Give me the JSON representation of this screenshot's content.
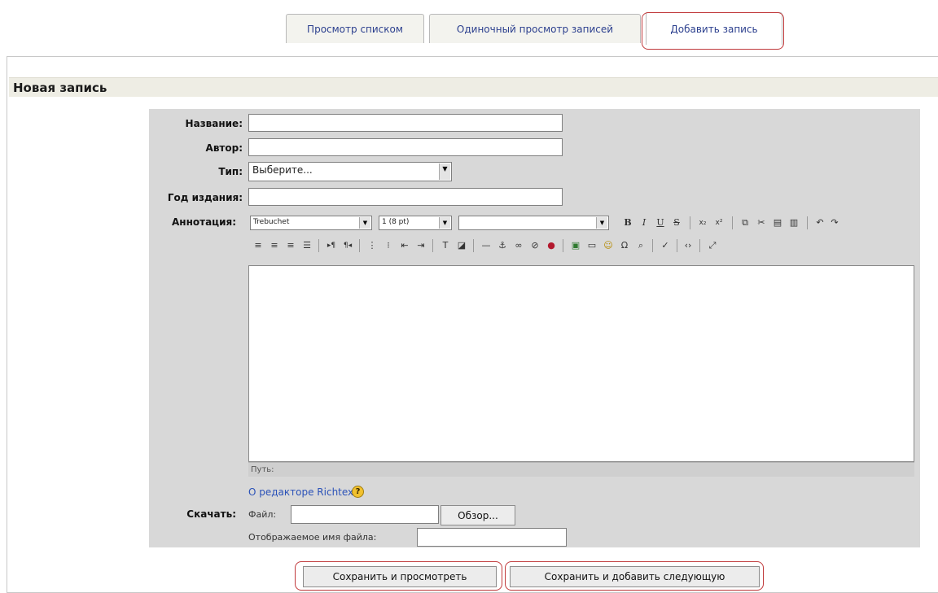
{
  "tabs": [
    {
      "label": "Просмотр списком"
    },
    {
      "label": "Одиночный просмотр записей"
    },
    {
      "label": "Добавить запись"
    }
  ],
  "section": {
    "title": "Новая запись"
  },
  "form": {
    "title_label": "Название:",
    "author_label": "Автор:",
    "type_label": "Тип:",
    "type_value": "Выберите...",
    "year_label": "Год издания:",
    "annotation_label": "Аннотация:",
    "download_label": "Скачать:",
    "file_label": "Файл:",
    "browse_label": "Обзор...",
    "display_name_label": "Отображаемое имя файла:"
  },
  "editor": {
    "font_value": "Trebuchet",
    "size_value": "1 (8 pt)",
    "format_value": "",
    "path_label": "Путь:",
    "about_link": "О редакторе Richtext",
    "help_icon": "?"
  },
  "buttons": {
    "save_view": "Сохранить и просмотреть",
    "save_next": "Сохранить и добавить следующую"
  },
  "colors": {
    "accent_outline": "#c0393b",
    "link": "#2b52b8",
    "panel": "#d8d8d8"
  }
}
